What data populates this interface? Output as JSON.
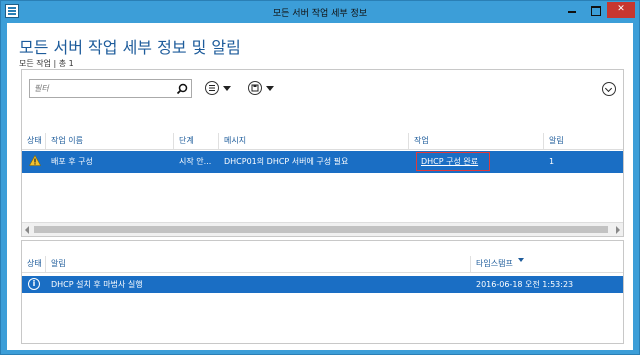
{
  "window": {
    "title": "모든 서버 작업 세부 정보"
  },
  "page": {
    "heading": "모든 서버 작업 세부 정보 및 알림",
    "subheading": "모든 작업 | 총 1"
  },
  "toolbar": {
    "filter_placeholder": "필터"
  },
  "tasks": {
    "columns": [
      "상태",
      "작업 이름",
      "단계",
      "메시지",
      "작업",
      "알림"
    ],
    "rows": [
      {
        "status_icon": "warning-icon",
        "name": "배포 후 구성",
        "stage": "시작 안...",
        "message": "DHCP01의 DHCP 서버에 구성 필요",
        "action": "DHCP 구성 완료",
        "notifications": "1"
      }
    ]
  },
  "notifications": {
    "columns": [
      "상태",
      "알림",
      "타임스탬프"
    ],
    "rows": [
      {
        "status_icon": "info-icon",
        "message": "DHCP 설치 후 마법사 실행",
        "timestamp": "2016-06-18 오전 1:53:23"
      }
    ]
  },
  "colors": {
    "accent": "#1e5c9b",
    "selected_row": "#1a6ec4",
    "window_frame": "#3c9ed8",
    "close_button": "#c7372f",
    "highlight_box": "#e03a3a"
  }
}
